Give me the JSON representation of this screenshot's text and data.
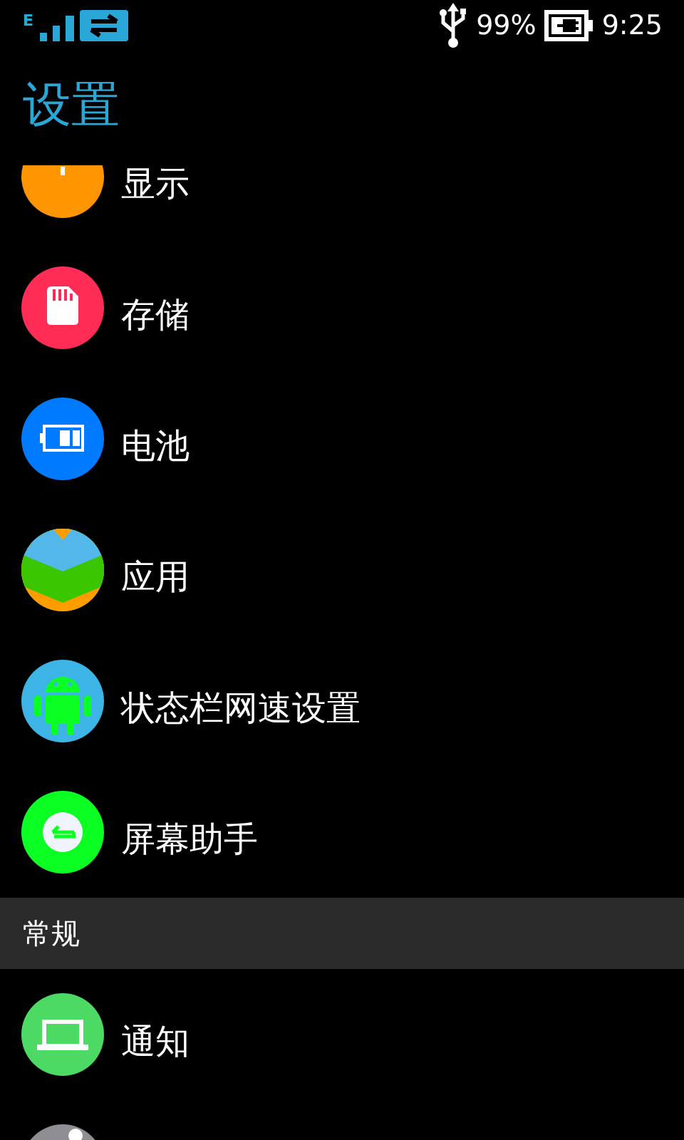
{
  "status_bar": {
    "network_type": "E",
    "battery_percent": "99%",
    "time": "9:25"
  },
  "title": "设置",
  "entries": [
    {
      "kind": "item",
      "label": "显示",
      "color": "#ff9500"
    },
    {
      "kind": "item",
      "label": "存储",
      "color": "#ff2d55"
    },
    {
      "kind": "item",
      "label": "电池",
      "color": "#007aff"
    },
    {
      "kind": "item",
      "label": "应用",
      "color": "#3ac600"
    },
    {
      "kind": "item",
      "label": "状态栏网速设置",
      "color": "#3cb4e5"
    },
    {
      "kind": "item",
      "label": "屏幕助手",
      "color": "#0cff22"
    },
    {
      "kind": "header",
      "label": "常规"
    },
    {
      "kind": "item",
      "label": "通知",
      "color": "#4cd964"
    },
    {
      "kind": "item",
      "color": "#8e8e93"
    }
  ]
}
